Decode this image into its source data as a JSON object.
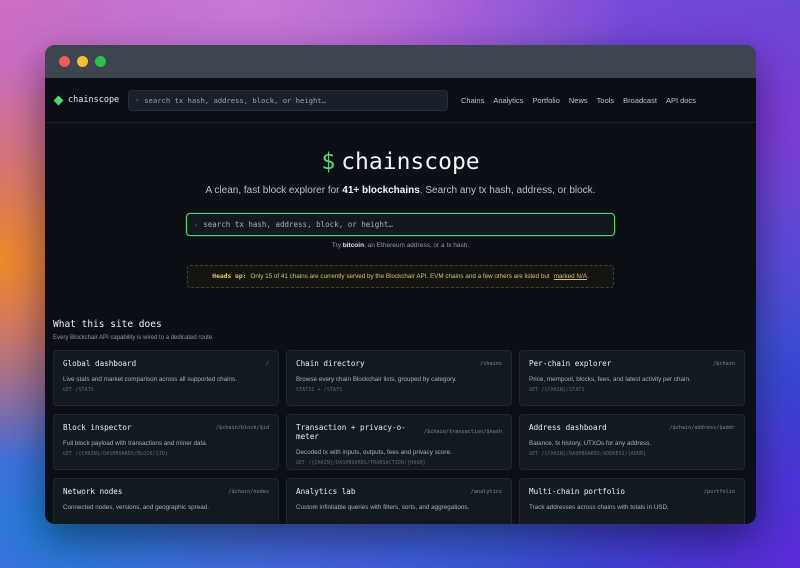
{
  "nav": {
    "brand": "chainscope",
    "search_placeholder": "search tx hash, address, block, or height…",
    "links": [
      "Chains",
      "Analytics",
      "Portfolio",
      "News",
      "Tools",
      "Broadcast",
      "API docs"
    ]
  },
  "hero": {
    "prompt": "$",
    "title": "chainscope",
    "tagline_pre": "A clean, fast block explorer for ",
    "tagline_bold": "41+ blockchains",
    "tagline_post": ". Search any tx hash, address, or block.",
    "search_placeholder": "search tx hash, address, block, or height…",
    "try_pre": "Try ",
    "try_bold": "bitcoin",
    "try_post": ", an Ethereum address, or a tx hash."
  },
  "notice": {
    "label": "Heads up:",
    "text": "Only 15 of 41 chains are currently served by the Blockchair API. EVM chains and a few others are listed but",
    "link": "marked N/A",
    "end": "."
  },
  "section": {
    "title": "What this site does",
    "subtitle": "Every Blockchair API capability is wired to a dedicated route."
  },
  "cards": [
    {
      "title": "Global dashboard",
      "route": "/",
      "desc": "Live stats and market comparison across all supported chains.",
      "api": "GET /STATS"
    },
    {
      "title": "Chain directory",
      "route": "/chains",
      "desc": "Browse every chain Blockchair lists, grouped by category.",
      "api": "STATIC + /STATS"
    },
    {
      "title": "Per-chain explorer",
      "route": "/$chain",
      "desc": "Price, mempool, blocks, fees, and latest activity per chain.",
      "api": "GET /{CHAIN}/STATS"
    },
    {
      "title": "Block inspector",
      "route": "/$chain/block/$id",
      "desc": "Full block payload with transactions and miner data.",
      "api": "GET /{CHAIN}/DASHBOARDS/BLOCK/{ID}"
    },
    {
      "title": "Transaction + privacy-o-meter",
      "route": "/$chain/transaction/$hash",
      "desc": "Decoded tx with inputs, outputs, fees and privacy score.",
      "api": "GET /{CHAIN}/DASHBOARDS/TRANSACTION/{HASH}"
    },
    {
      "title": "Address dashboard",
      "route": "/$chain/address/$addr",
      "desc": "Balance, tx history, UTXOs for any address.",
      "api": "GET /{CHAIN}/DASHBOARDS/ADDRESS/{ADDR}"
    },
    {
      "title": "Network nodes",
      "route": "/$chain/nodes",
      "desc": "Connected nodes, versions, and geographic spread.",
      "api": ""
    },
    {
      "title": "Analytics lab",
      "route": "/analytics",
      "desc": "Custom infinitable queries with filters, sorts, and aggregations.",
      "api": ""
    },
    {
      "title": "Multi-chain portfolio",
      "route": "/portfolio",
      "desc": "Track addresses across chains with totals in USD.",
      "api": ""
    }
  ]
}
